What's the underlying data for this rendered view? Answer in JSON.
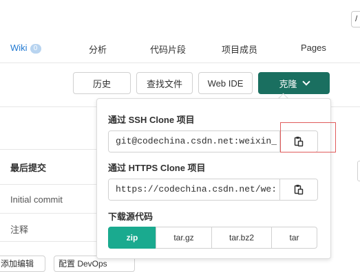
{
  "top": {
    "corner_glyph": "/"
  },
  "nav": {
    "wiki_label": "Wiki",
    "wiki_count": "0",
    "analysis": "分析",
    "snippets": "代码片段",
    "members": "项目成员",
    "pages": "Pages"
  },
  "toolbar": {
    "history": "历史",
    "find_file": "查找文件",
    "web_ide": "Web IDE",
    "clone": "克隆"
  },
  "table": {
    "header_last_commit": "最后提交",
    "rows": [
      "Initial commit",
      "注释"
    ]
  },
  "clone_dropdown": {
    "ssh_title": "通过 SSH Clone 项目",
    "ssh_url": "git@codechina.csdn.net:weixin_",
    "https_title": "通过 HTTPS Clone 项目",
    "https_url": "https://codechina.csdn.net/we:",
    "download_title": "下载源代码",
    "formats": [
      "zip",
      "tar.gz",
      "tar.bz2",
      "tar"
    ],
    "selected_format": "zip"
  },
  "bottom": {
    "left_btn": "添加编辑",
    "right_btn": "配置 DevOps"
  },
  "colors": {
    "clone_button": "#1a6f60",
    "active_format": "#1aaa8f",
    "link_blue": "#1f78d1",
    "highlight": "#e05a5a"
  },
  "icons": {
    "copy": "clipboard-icon",
    "dropdown": "chevron-down-icon"
  }
}
